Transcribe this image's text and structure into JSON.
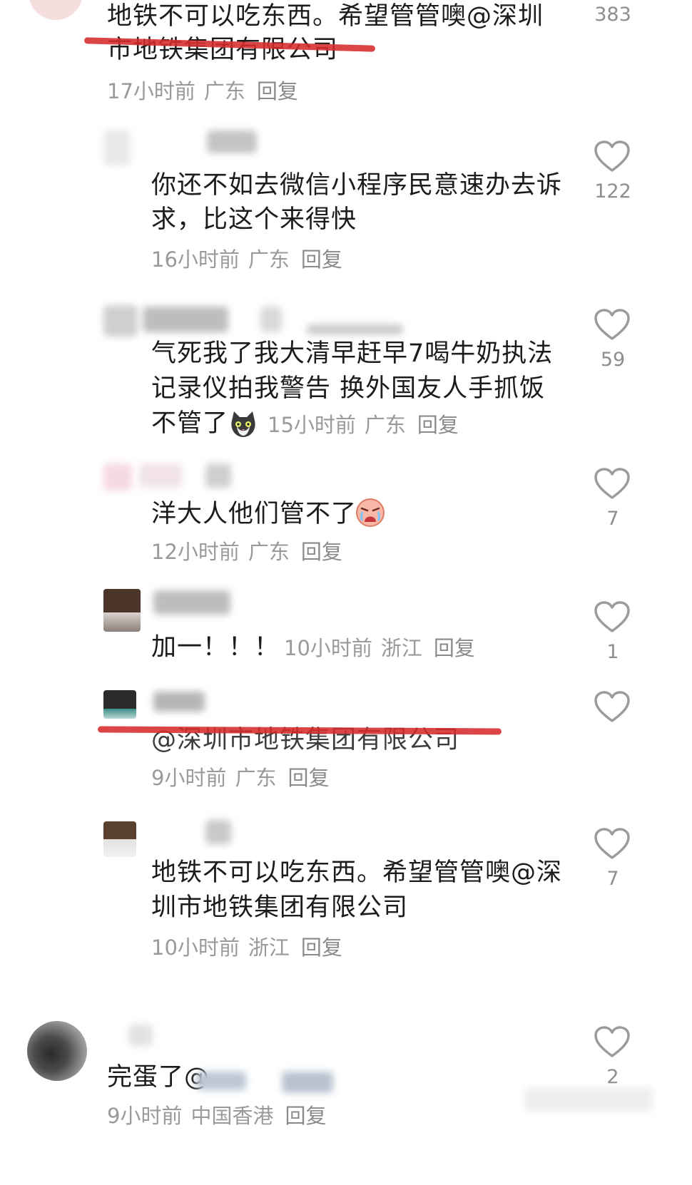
{
  "comments": [
    {
      "id": "c0",
      "text_lines": [
        "地铁不可以吃东西。希望管管噢@深圳",
        "市地铁集团有限公司"
      ],
      "time": "17小时前",
      "location": "广东",
      "reply_label": "回复",
      "likes": "383"
    },
    {
      "id": "c1",
      "text_lines": [
        "你还不如去微信小程序民意速办去诉",
        "求，比这个来得快"
      ],
      "time": "16小时前",
      "location": "广东",
      "reply_label": "回复",
      "likes": "122"
    },
    {
      "id": "c2",
      "text_lines": [
        "气死我了我大清早赶早7喝牛奶执法",
        "记录仪拍我警告 换外国友人手抓饭",
        "不管了"
      ],
      "emoji": "cat-emoji",
      "time": "15小时前",
      "location": "广东",
      "reply_label": "回复",
      "likes": "59"
    },
    {
      "id": "c3",
      "text_lines": [
        "洋大人他们管不了"
      ],
      "emoji": "crying-face-emoji",
      "time": "12小时前",
      "location": "广东",
      "reply_label": "回复",
      "likes": "7"
    },
    {
      "id": "c4",
      "text_lines": [
        "加一！！！"
      ],
      "time": "10小时前",
      "location": "浙江",
      "reply_label": "回复",
      "likes": "1"
    },
    {
      "id": "c5",
      "text_lines": [
        "@深圳市地铁集团有限公司"
      ],
      "time": "9小时前",
      "location": "广东",
      "reply_label": "回复",
      "likes": ""
    },
    {
      "id": "c6",
      "text_lines": [
        "地铁不可以吃东西。希望管管噢@深",
        "圳市地铁集团有限公司"
      ],
      "time": "10小时前",
      "location": "浙江",
      "reply_label": "回复",
      "likes": "7"
    },
    {
      "id": "c7",
      "text_lines": [
        "完蛋了@"
      ],
      "time": "9小时前",
      "location": "中国香港",
      "reply_label": "回复",
      "likes": "2"
    }
  ],
  "colors": {
    "text": "#1c1c1c",
    "meta": "#9a9a9a",
    "heart_outline": "#9b9b9b",
    "annotation_red": "#d72b2b"
  }
}
